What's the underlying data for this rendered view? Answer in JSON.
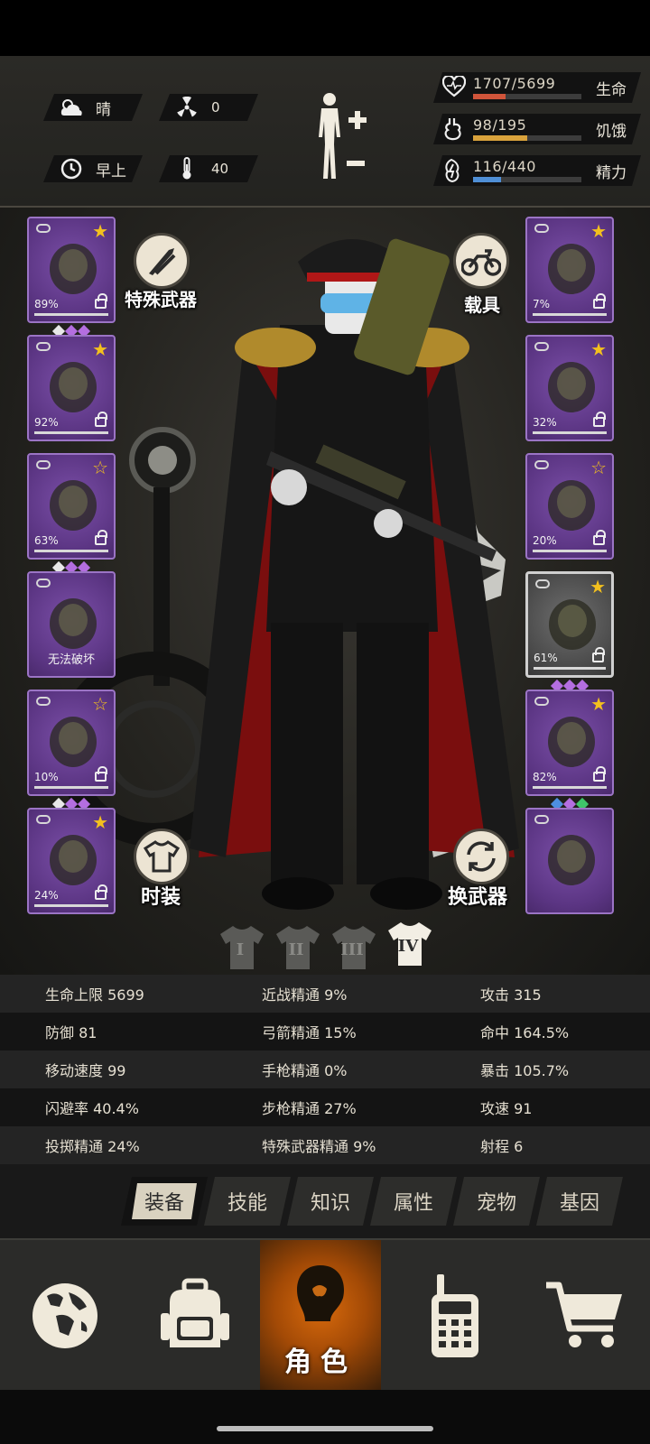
{
  "environment": {
    "weather": "晴",
    "radiation": "0",
    "time_of_day": "早上",
    "temperature": "40"
  },
  "vitals": [
    {
      "key": "health",
      "value": "1707/5699",
      "label": "生命",
      "fraction": 0.3,
      "color": "#d0543a",
      "icon": "heart-icon"
    },
    {
      "key": "hunger",
      "value": "98/195",
      "label": "饥饿",
      "fraction": 0.5,
      "color": "#d9a23c",
      "icon": "stomach-icon"
    },
    {
      "key": "energy",
      "value": "116/440",
      "label": "精力",
      "fraction": 0.26,
      "color": "#4f8fd6",
      "icon": "energy-icon"
    }
  ],
  "left_slots": [
    {
      "name": "helmet",
      "pct": "89%",
      "star": "full",
      "gems": [
        "#e8e8e8",
        "#b46ee0",
        "#b46ee0"
      ]
    },
    {
      "name": "shirt",
      "pct": "92%",
      "star": "full",
      "gems": []
    },
    {
      "name": "jacket",
      "pct": "63%",
      "star": "outline",
      "gems": [
        "#e8e8e8",
        "#b46ee0",
        "#b46ee0"
      ]
    },
    {
      "name": "backpack",
      "note": "无法破坏",
      "gems": []
    },
    {
      "name": "pants",
      "pct": "10%",
      "star": "outline",
      "gems": [
        "#e8e8e8",
        "#b46ee0",
        "#b46ee0"
      ]
    },
    {
      "name": "boots",
      "pct": "24%",
      "star": "full",
      "gems": []
    }
  ],
  "right_slots": [
    {
      "name": "goggles",
      "pct": "7%",
      "star": "full",
      "gems": []
    },
    {
      "name": "gas-mask",
      "pct": "32%",
      "star": "full",
      "gems": []
    },
    {
      "name": "vest",
      "pct": "20%",
      "star": "outline",
      "gems": []
    },
    {
      "name": "rifle",
      "pct": "61%",
      "star": "full",
      "gems": [
        "#b46ee0",
        "#b46ee0",
        "#b46ee0"
      ],
      "selected": true
    },
    {
      "name": "machete",
      "pct": "82%",
      "star": "full",
      "gems": [
        "#4d8fe0",
        "#b46ee0",
        "#3fc46a"
      ]
    },
    {
      "name": "grenade",
      "gems": []
    }
  ],
  "buttons": {
    "special_weapon": "特殊武器",
    "vehicle": "载具",
    "fashion": "时装",
    "switch_weapon": "换武器"
  },
  "outfits": [
    "I",
    "II",
    "III",
    "IV"
  ],
  "outfit_active": 3,
  "stats": [
    [
      "生命上限 5699",
      "近战精通 9%",
      "攻击 315"
    ],
    [
      "防御 81",
      "弓箭精通 15%",
      "命中 164.5%"
    ],
    [
      "移动速度 99",
      "手枪精通 0%",
      "暴击 105.7%"
    ],
    [
      "闪避率 40.4%",
      "步枪精通 27%",
      "攻速 91"
    ],
    [
      "投掷精通 24%",
      "特殊武器精通 9%",
      "射程 6"
    ]
  ],
  "tabs": [
    "装备",
    "技能",
    "知识",
    "属性",
    "宠物",
    "基因"
  ],
  "tab_active": 0,
  "nav": {
    "active_label": "角色",
    "items": [
      "globe-icon",
      "backpack-icon",
      "character-icon",
      "radio-icon",
      "cart-icon"
    ]
  }
}
